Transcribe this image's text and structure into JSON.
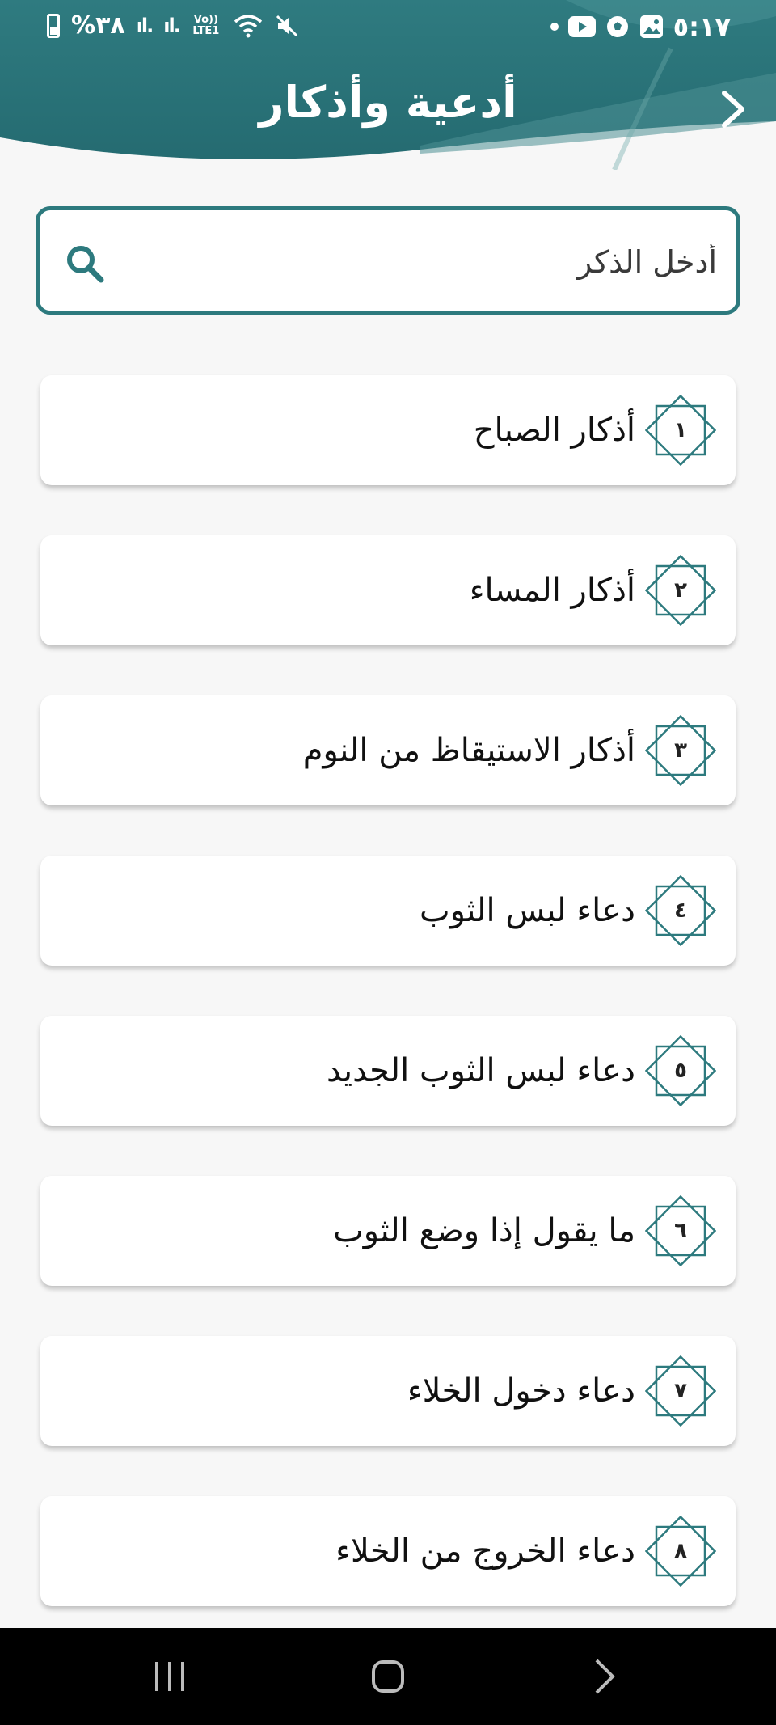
{
  "status_bar": {
    "time": "٥:١٧",
    "battery": "%٣٨",
    "network": "Vo)) LTE1",
    "icons": [
      "dot",
      "youtube-icon",
      "football-icon",
      "gallery-icon",
      "wifi-icon",
      "mute-icon",
      "signal-icon"
    ]
  },
  "header": {
    "title": "أدعية وأذكار",
    "back_icon": "chevron-icon",
    "color": "#2f7b80"
  },
  "search": {
    "placeholder": "أدخل الذكر",
    "icon": "search-icon"
  },
  "items": [
    {
      "num": "١",
      "label": "أذكار الصباح"
    },
    {
      "num": "٢",
      "label": "أذكار المساء"
    },
    {
      "num": "٣",
      "label": "أذكار الاستيقاظ من النوم"
    },
    {
      "num": "٤",
      "label": "دعاء لبس الثوب"
    },
    {
      "num": "٥",
      "label": "دعاء لبس الثوب الجديد"
    },
    {
      "num": "٦",
      "label": "ما يقول إذا وضع الثوب"
    },
    {
      "num": "٧",
      "label": "دعاء دخول الخلاء"
    },
    {
      "num": "٨",
      "label": "دعاء الخروج من الخلاء"
    }
  ],
  "navbar": {
    "icons": [
      "recent-apps-icon",
      "home-icon",
      "back-icon"
    ]
  },
  "colors": {
    "accent": "#2d7a7e",
    "background": "#f7f7f7"
  }
}
